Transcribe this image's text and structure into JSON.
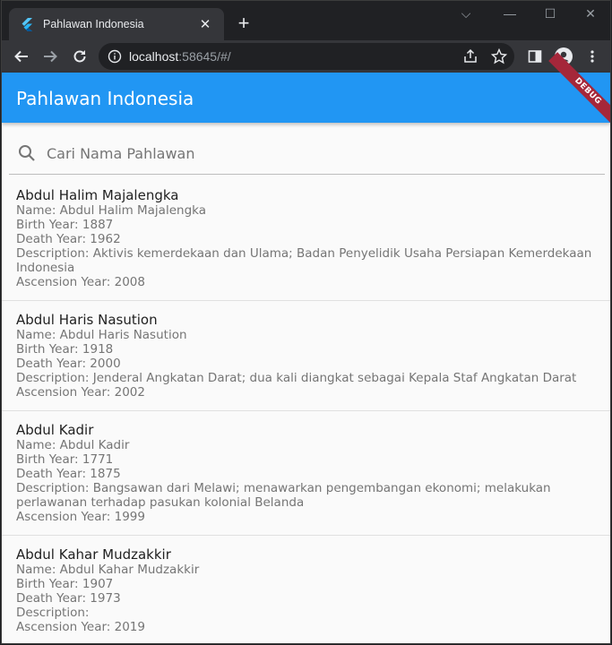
{
  "browser": {
    "tab_title": "Pahlawan Indonesia",
    "url_host": "localhost",
    "url_rest": ":58645/#/"
  },
  "appbar": {
    "title": "Pahlawan Indonesia",
    "debug_label": "DEBUG",
    "color": "#2196f3"
  },
  "search": {
    "placeholder": "Cari Nama Pahlawan",
    "value": ""
  },
  "heroes": [
    {
      "title": "Abdul Halim Majalengka",
      "name": "Name: Abdul Halim Majalengka",
      "birth": "Birth Year: 1887",
      "death": "Death Year: 1962",
      "description": "Description: Aktivis kemerdekaan dan Ulama; Badan Penyelidik Usaha Persiapan Kemerdekaan Indonesia",
      "ascension": "Ascension Year: 2008"
    },
    {
      "title": "Abdul Haris Nasution",
      "name": "Name: Abdul Haris Nasution",
      "birth": "Birth Year: 1918",
      "death": "Death Year: 2000",
      "description": "Description: Jenderal Angkatan Darat; dua kali diangkat sebagai Kepala Staf Angkatan Darat",
      "ascension": "Ascension Year: 2002"
    },
    {
      "title": "Abdul Kadir",
      "name": "Name: Abdul Kadir",
      "birth": "Birth Year: 1771",
      "death": "Death Year: 1875",
      "description": "Description: Bangsawan dari Melawi; menawarkan pengembangan ekonomi; melakukan perlawanan terhadap pasukan kolonial Belanda",
      "ascension": "Ascension Year: 1999"
    },
    {
      "title": "Abdul Kahar Mudzakkir",
      "name": "Name: Abdul Kahar Mudzakkir",
      "birth": "Birth Year: 1907",
      "death": "Death Year: 1973",
      "description": "Description:",
      "ascension": "Ascension Year: 2019"
    }
  ]
}
